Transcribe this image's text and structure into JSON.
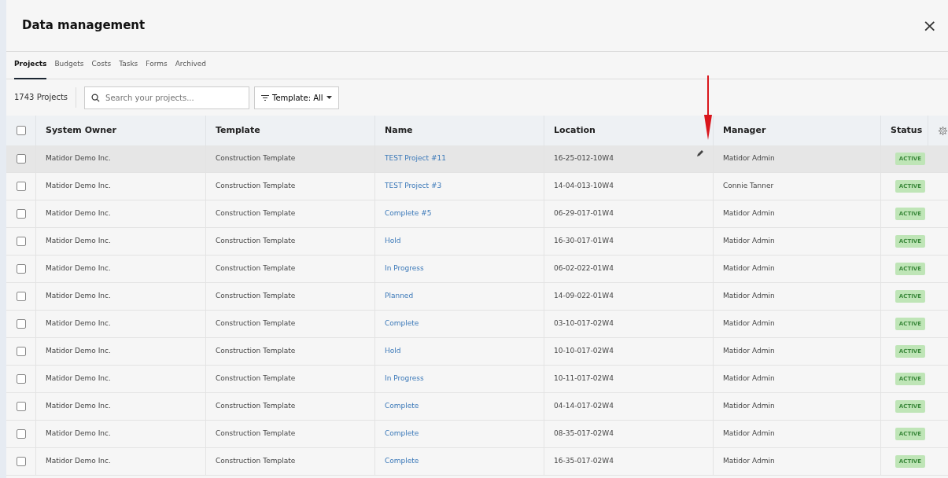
{
  "dialog": {
    "title": "Data management",
    "close": "×"
  },
  "tabs": [
    {
      "label": "Projects",
      "selected": true
    },
    {
      "label": "Budgets",
      "selected": false
    },
    {
      "label": "Costs",
      "selected": false
    },
    {
      "label": "Tasks",
      "selected": false
    },
    {
      "label": "Forms",
      "selected": false
    },
    {
      "label": "Archived",
      "selected": false
    }
  ],
  "toolbar": {
    "count": "1743 Projects",
    "search": {
      "placeholder": "Search your projects..."
    },
    "filter": "Template: All"
  },
  "table": {
    "all_checked": false,
    "columns": [
      "System Owner",
      "Template",
      "Name",
      "Location",
      "Manager",
      "Status"
    ],
    "rows": [
      {
        "owner": "Matidor Demo Inc.",
        "template": "Construction Template",
        "name": "TEST Project #11",
        "location": "16-25-012-10W4",
        "manager": "Matidor Admin",
        "status": "ACTIVE",
        "checked": false,
        "highlighted": true,
        "editing": true
      },
      {
        "owner": "Matidor Demo Inc.",
        "template": "Construction Template",
        "name": "TEST Project #3",
        "location": "14-04-013-10W4",
        "manager": "Connie Tanner",
        "status": "ACTIVE",
        "checked": false,
        "highlighted": false,
        "editing": false
      },
      {
        "owner": "Matidor Demo Inc.",
        "template": "Construction Template",
        "name": "Complete #5",
        "location": "06-29-017-01W4",
        "manager": "Matidor Admin",
        "status": "ACTIVE",
        "checked": false,
        "highlighted": false,
        "editing": false
      },
      {
        "owner": "Matidor Demo Inc.",
        "template": "Construction Template",
        "name": "Hold",
        "location": "16-30-017-01W4",
        "manager": "Matidor Admin",
        "status": "ACTIVE",
        "checked": false,
        "highlighted": false,
        "editing": false
      },
      {
        "owner": "Matidor Demo Inc.",
        "template": "Construction Template",
        "name": "In Progress",
        "location": "06-02-022-01W4",
        "manager": "Matidor Admin",
        "status": "ACTIVE",
        "checked": false,
        "highlighted": false,
        "editing": false
      },
      {
        "owner": "Matidor Demo Inc.",
        "template": "Construction Template",
        "name": "Planned",
        "location": "14-09-022-01W4",
        "manager": "Matidor Admin",
        "status": "ACTIVE",
        "checked": false,
        "highlighted": false,
        "editing": false
      },
      {
        "owner": "Matidor Demo Inc.",
        "template": "Construction Template",
        "name": "Complete",
        "location": "03-10-017-02W4",
        "manager": "Matidor Admin",
        "status": "ACTIVE",
        "checked": false,
        "highlighted": false,
        "editing": false
      },
      {
        "owner": "Matidor Demo Inc.",
        "template": "Construction Template",
        "name": "Hold",
        "location": "10-10-017-02W4",
        "manager": "Matidor Admin",
        "status": "ACTIVE",
        "checked": false,
        "highlighted": false,
        "editing": false
      },
      {
        "owner": "Matidor Demo Inc.",
        "template": "Construction Template",
        "name": "In Progress",
        "location": "10-11-017-02W4",
        "manager": "Matidor Admin",
        "status": "ACTIVE",
        "checked": false,
        "highlighted": false,
        "editing": false
      },
      {
        "owner": "Matidor Demo Inc.",
        "template": "Construction Template",
        "name": "Complete",
        "location": "04-14-017-02W4",
        "manager": "Matidor Admin",
        "status": "ACTIVE",
        "checked": false,
        "highlighted": false,
        "editing": false
      },
      {
        "owner": "Matidor Demo Inc.",
        "template": "Construction Template",
        "name": "Complete",
        "location": "08-35-017-02W4",
        "manager": "Matidor Admin",
        "status": "ACTIVE",
        "checked": false,
        "highlighted": false,
        "editing": false
      },
      {
        "owner": "Matidor Demo Inc.",
        "template": "Construction Template",
        "name": "Complete",
        "location": "16-35-017-02W4",
        "manager": "Matidor Admin",
        "status": "ACTIVE",
        "checked": false,
        "highlighted": false,
        "editing": false
      }
    ]
  }
}
